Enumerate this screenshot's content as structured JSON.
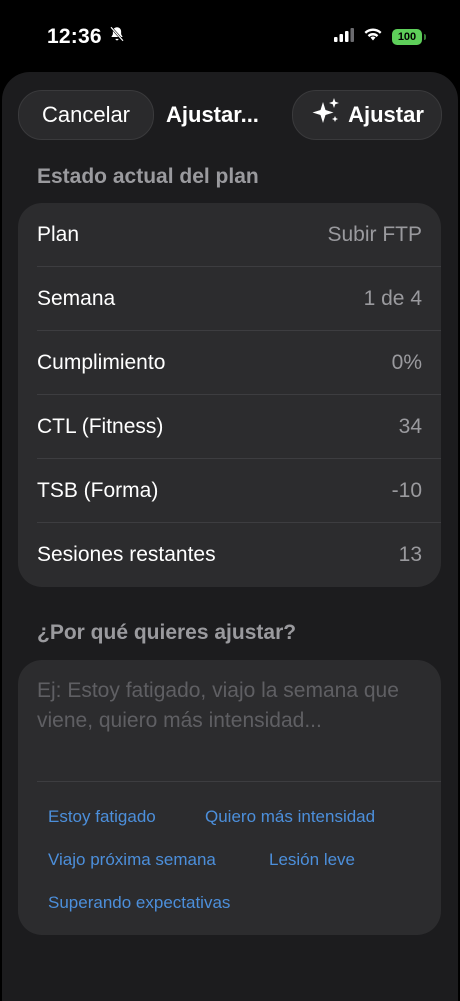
{
  "status": {
    "time": "12:36",
    "battery": "100"
  },
  "nav": {
    "cancel_label": "Cancelar",
    "title": "Ajustar...",
    "adjust_label": "Ajustar"
  },
  "plan_section": {
    "title": "Estado actual del plan",
    "rows": [
      {
        "label": "Plan",
        "value": "Subir FTP"
      },
      {
        "label": "Semana",
        "value": "1 de 4"
      },
      {
        "label": "Cumplimiento",
        "value": "0%"
      },
      {
        "label": "CTL (Fitness)",
        "value": "34"
      },
      {
        "label": "TSB (Forma)",
        "value": "-10"
      },
      {
        "label": "Sesiones restantes",
        "value": "13"
      }
    ]
  },
  "reason_section": {
    "title": "¿Por qué quieres ajustar?",
    "placeholder": "Ej: Estoy fatigado, viajo la semana que viene, quiero más intensidad...",
    "chips": [
      "Estoy fatigado",
      "Quiero más intensidad",
      "Viajo próxima semana",
      "Lesión leve",
      "Superando expectativas"
    ]
  },
  "colors": {
    "accent": "#4c8fdb",
    "battery": "#5ecf5a",
    "card": "#2c2c2e",
    "sheet": "#1c1c1e"
  }
}
